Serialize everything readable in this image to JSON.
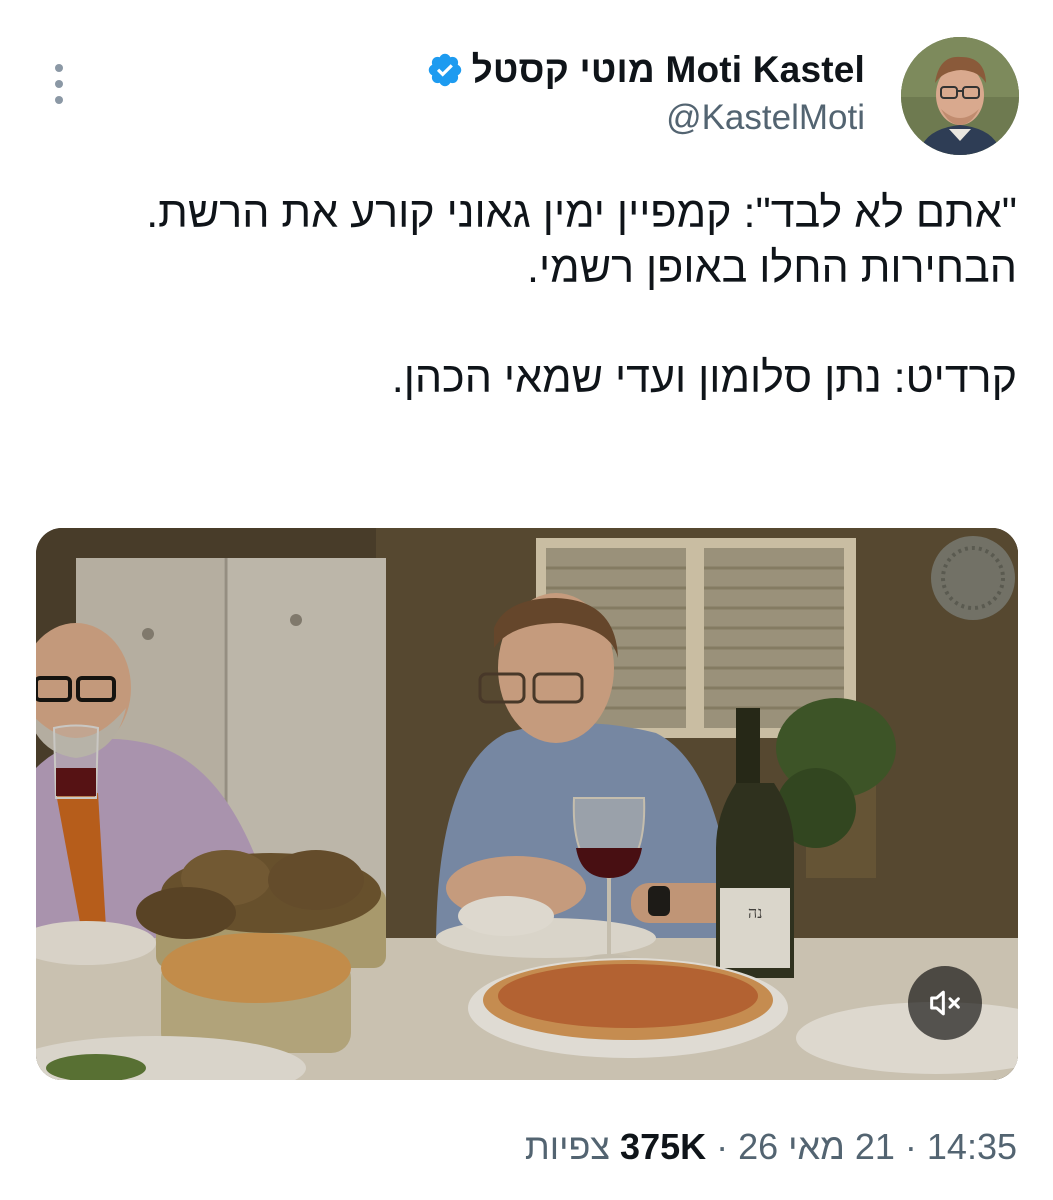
{
  "author": {
    "display_name": "Moti Kastel מוטי קסטל",
    "handle": "@KastelMoti",
    "verified": true
  },
  "tweet": {
    "paragraphs": [
      "\"אתם לא לבד\": קמפיין ימין גאוני קורע את הרשת. הבחירות החלו באופן רשמי.",
      "קרדיט: נתן סלומון ועדי שמאי הכהן."
    ]
  },
  "media": {
    "type": "video",
    "muted": true,
    "bottle_label": "נה"
  },
  "meta": {
    "time": "14:35",
    "sep1": "·",
    "date": "21 מאי 26",
    "sep2": "·",
    "views_count": "375K",
    "views_label": "צפיות"
  },
  "colors": {
    "text_primary": "#0f1419",
    "text_secondary": "#536471",
    "verified_blue": "#1d9bf0",
    "more_dots": "#8b98a5"
  },
  "icons": {
    "more": "more-vertical-icon",
    "verified": "verified-badge-icon",
    "mute": "speaker-muted-icon"
  }
}
